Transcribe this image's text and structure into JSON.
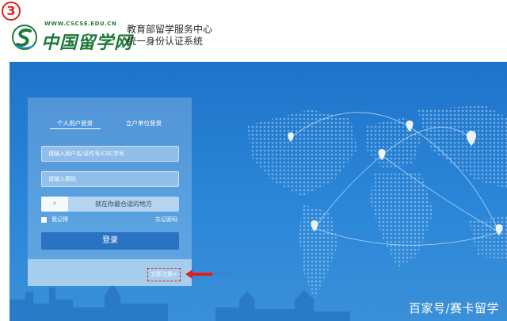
{
  "step_number": "3",
  "header": {
    "site_url": "WWW.CSCSE.EDU.CN",
    "site_name": "中国留学网",
    "org_name_line1": "教育部留学服务中心",
    "org_name_line2": "统一身份认证系统"
  },
  "login": {
    "tabs": [
      {
        "label": "个人用户登录",
        "active": true
      },
      {
        "label": "立户单位登录",
        "active": false
      }
    ],
    "username_placeholder": "请输入用户名/证件号/CSC学号",
    "password_placeholder": "请输入密码",
    "slider_handle": "»",
    "slider_text": "就在你最合适的地方",
    "remember_label": "我记得",
    "forgot_label": "忘记密码",
    "login_button": "登录",
    "register_link": "立即注册>"
  },
  "watermark": "百家号/赛卡留学",
  "colors": {
    "banner_blue": "#1e73c8",
    "login_button": "#2a73c3",
    "highlight_red": "#e02020",
    "brand_green": "#1d7a3a"
  },
  "icons": [
    "logo-emblem-icon",
    "map-pin-icon",
    "slider-arrow-icon",
    "red-arrow-icon"
  ]
}
